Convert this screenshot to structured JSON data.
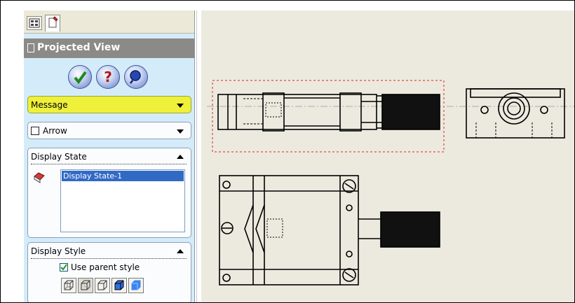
{
  "panel": {
    "title": "Projected View",
    "actions": [
      "ok-icon",
      "help-icon",
      "detailed-preview-icon"
    ],
    "message_label": "Message",
    "arrow_label": "Arrow",
    "arrow_checked": false,
    "display_state": {
      "label": "Display State",
      "items": [
        "Display State-1"
      ],
      "selected": "Display State-1"
    },
    "display_style": {
      "label": "Display Style",
      "use_parent_label": "Use parent style",
      "use_parent_checked": true,
      "buttons": [
        "wireframe-icon",
        "hidden-lines-visible-icon",
        "hidden-lines-removed-icon",
        "shaded-with-edges-icon",
        "shaded-icon"
      ]
    }
  },
  "colors": {
    "panel_bg": "#d4ecfa",
    "title_bg": "#8b8a87",
    "message_bg": "#eef03a",
    "selection": "#316ac5",
    "canvas_bg": "#eceadf",
    "preview_frame": "#e02020"
  }
}
